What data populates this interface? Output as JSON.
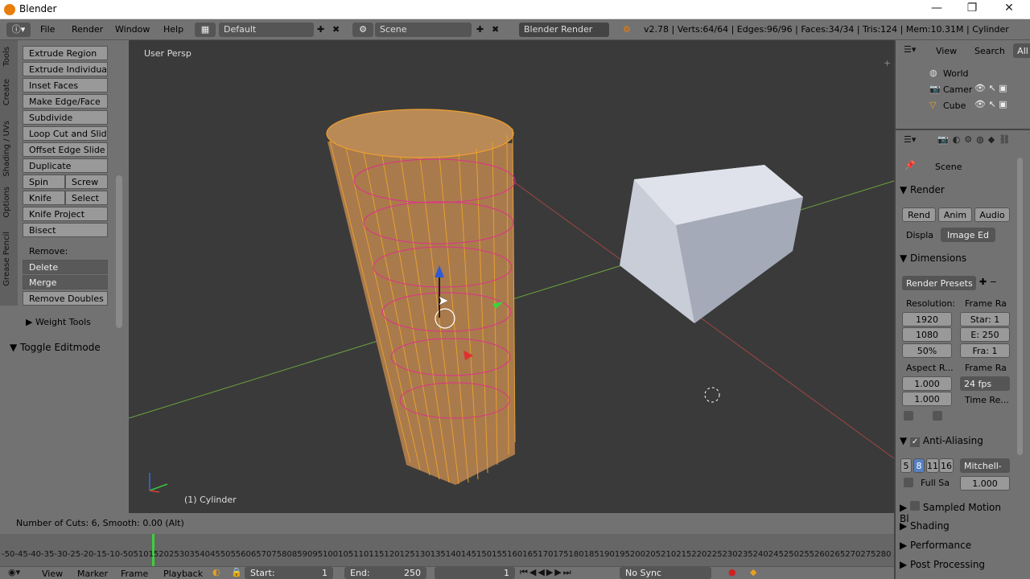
{
  "window": {
    "title": "Blender",
    "minimize": "—",
    "maximize": "❐",
    "close": "✕"
  },
  "menu": {
    "items": [
      "File",
      "Render",
      "Window",
      "Help"
    ],
    "layout": "Default",
    "scene": "Scene",
    "engine": "Blender Render",
    "info": "v2.78 | Verts:64/64 | Edges:96/96 | Faces:34/34 | Tris:124 | Mem:10.31M | Cylinder"
  },
  "toolshelf": {
    "tabs": [
      "Tools",
      "Create",
      "Shading / UVs",
      "Options",
      "Grease Pencil"
    ],
    "buttons": [
      "Extrude Region",
      "Extrude Individual",
      "Inset Faces",
      "Make Edge/Face",
      "Subdivide",
      "Loop Cut and Slide",
      "Offset Edge Slide",
      "Duplicate"
    ],
    "spin": "Spin",
    "screw": "Screw",
    "knife": "Knife",
    "select": "Select",
    "knife_project": "Knife Project",
    "bisect": "Bisect",
    "remove_label": "Remove:",
    "delete": "Delete",
    "merge": "Merge",
    "remove_doubles": "Remove Doubles",
    "weight_tools": "Weight Tools",
    "toggle_editmode": "Toggle Editmode"
  },
  "viewport": {
    "view_label": "User Persp",
    "object_label": "(1) Cylinder"
  },
  "status": {
    "text": "Number of Cuts: 6, Smooth: 0.00 (Alt)"
  },
  "timeline": {
    "ticks": [
      "-50",
      "-45",
      "-40",
      "-35",
      "-30",
      "-25",
      "-20",
      "-15",
      "-10",
      "-5",
      "0",
      "5",
      "10",
      "15",
      "20",
      "25",
      "30",
      "35",
      "40",
      "45",
      "50",
      "55",
      "60",
      "65",
      "70",
      "75",
      "80",
      "85",
      "90",
      "95",
      "100",
      "105",
      "110",
      "115",
      "120",
      "125",
      "130",
      "135",
      "140",
      "145",
      "150",
      "155",
      "160",
      "165",
      "170",
      "175",
      "180",
      "185",
      "190",
      "195",
      "200",
      "205",
      "210",
      "215",
      "220",
      "225",
      "230",
      "235",
      "240",
      "245",
      "250",
      "255",
      "260",
      "265",
      "270",
      "275",
      "280"
    ],
    "current_frame": 0
  },
  "timebar": {
    "view": "View",
    "marker": "Marker",
    "frame": "Frame",
    "playback": "Playback",
    "start": "Start:",
    "start_val": "1",
    "end": "End:",
    "end_val": "250",
    "current": "1",
    "sync": "No Sync"
  },
  "outliner": {
    "view": "View",
    "search": "Search",
    "all": "All",
    "items": [
      "World",
      "Camer",
      "Cube"
    ]
  },
  "properties": {
    "scene": "Scene",
    "render": "Render",
    "render_btn": "Rend",
    "anim_btn": "Anim",
    "audio_btn": "Audio",
    "display": "Displa",
    "display_val": "Image Ed",
    "dimensions": "Dimensions",
    "presets": "Render Presets",
    "resolution": "Resolution:",
    "res_x": "1920",
    "res_y": "1080",
    "res_pct": "50%",
    "frame_range": "Frame Ra",
    "start": "Star: 1",
    "end": "E: 250",
    "step": "Fra: 1",
    "aspect": "Aspect R...",
    "aspect_x": "1.000",
    "aspect_y": "1.000",
    "frame_rate": "Frame Ra",
    "fps": "24 fps",
    "time_remap": "Time Re...",
    "anti_aliasing": "Anti-Aliasing",
    "aa_samples": [
      "5",
      "8",
      "11",
      "16"
    ],
    "aa_filter": "Mitchell-",
    "full_sample": "Full Sa",
    "filter_size": "1.000",
    "sampled_motion": "Sampled Motion Bl",
    "shading": "Shading",
    "performance": "Performance",
    "post_processing": "Post Processing"
  }
}
